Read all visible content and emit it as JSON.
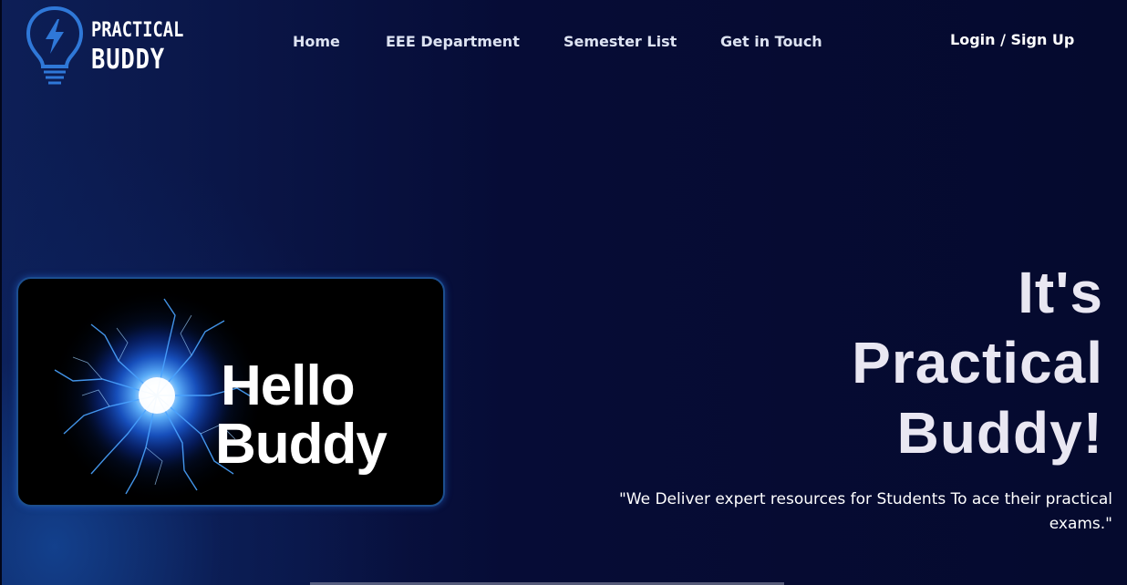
{
  "brand": {
    "line1": "PRACTICAL",
    "line2": "BUDDY",
    "icon": "lightbulb-bolt-icon",
    "accent": "#2f78d8"
  },
  "nav": {
    "home": "Home",
    "eee": "EEE Department",
    "semester": "Semester List",
    "touch": "Get in Touch"
  },
  "auth": {
    "login": "Login / Sign Up"
  },
  "hero_card": {
    "line1": "Hello",
    "line2": "Buddy",
    "image": "blue-plasma-energy-burst"
  },
  "headline": {
    "line1": "It's",
    "line2": "Practical",
    "line3": "Buddy!"
  },
  "tagline": "\"We Deliver expert resources for Students To ace their practical exams.\""
}
